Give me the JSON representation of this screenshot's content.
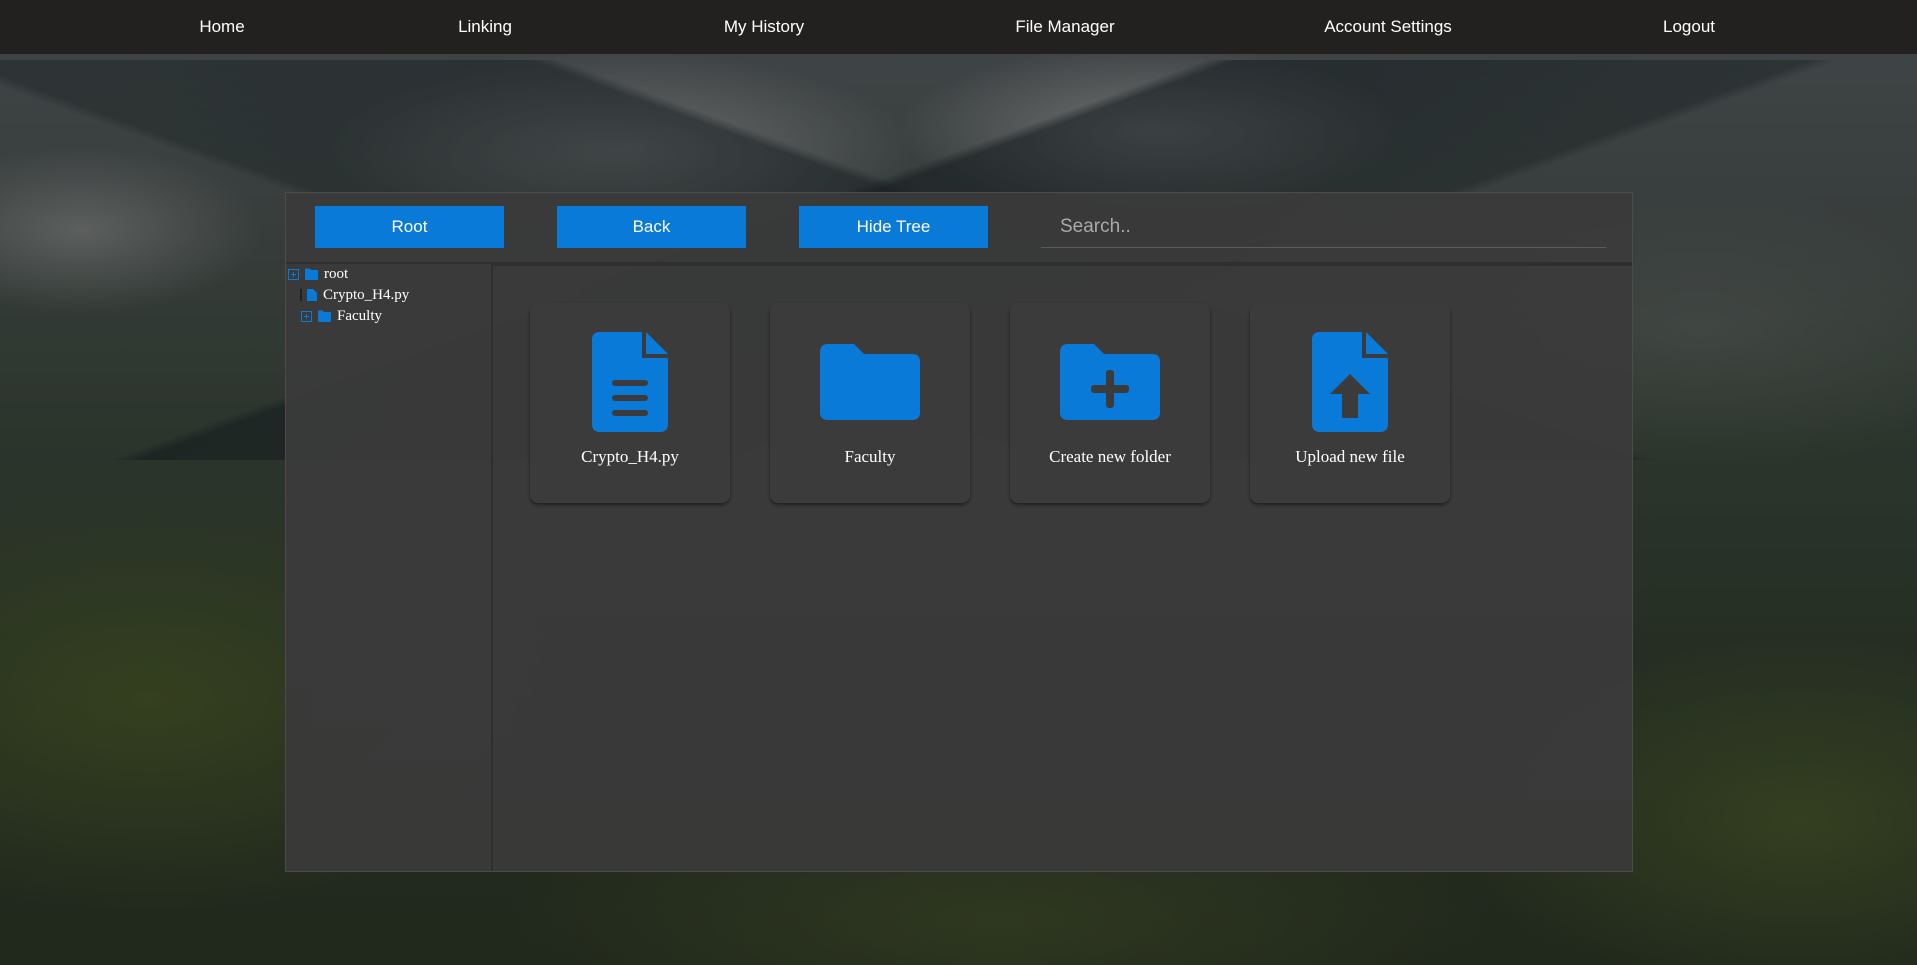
{
  "nav": {
    "items": [
      {
        "label": "Home"
      },
      {
        "label": "Linking"
      },
      {
        "label": "My History"
      },
      {
        "label": "File Manager"
      },
      {
        "label": "Account Settings"
      },
      {
        "label": "Logout"
      }
    ]
  },
  "toolbar": {
    "root_label": "Root",
    "back_label": "Back",
    "hide_tree_label": "Hide Tree",
    "search_placeholder": "Search.."
  },
  "tree": {
    "root": {
      "label": "root",
      "icon": "folder-icon"
    },
    "items": [
      {
        "label": "Crypto_H4.py",
        "icon": "file-icon"
      },
      {
        "label": "Faculty",
        "icon": "folder-icon"
      }
    ]
  },
  "tiles": [
    {
      "label": "Crypto_H4.py",
      "icon": "file-text-icon"
    },
    {
      "label": "Faculty",
      "icon": "folder-icon"
    },
    {
      "label": "Create new folder",
      "icon": "folder-plus-icon"
    },
    {
      "label": "Upload new file",
      "icon": "file-upload-icon"
    }
  ],
  "colors": {
    "accent": "#0a7ad8",
    "nav_bg": "#232120",
    "panel_bg": "#3a3a3a",
    "tile_bg": "#3b3b3b",
    "text": "#ffffff"
  }
}
